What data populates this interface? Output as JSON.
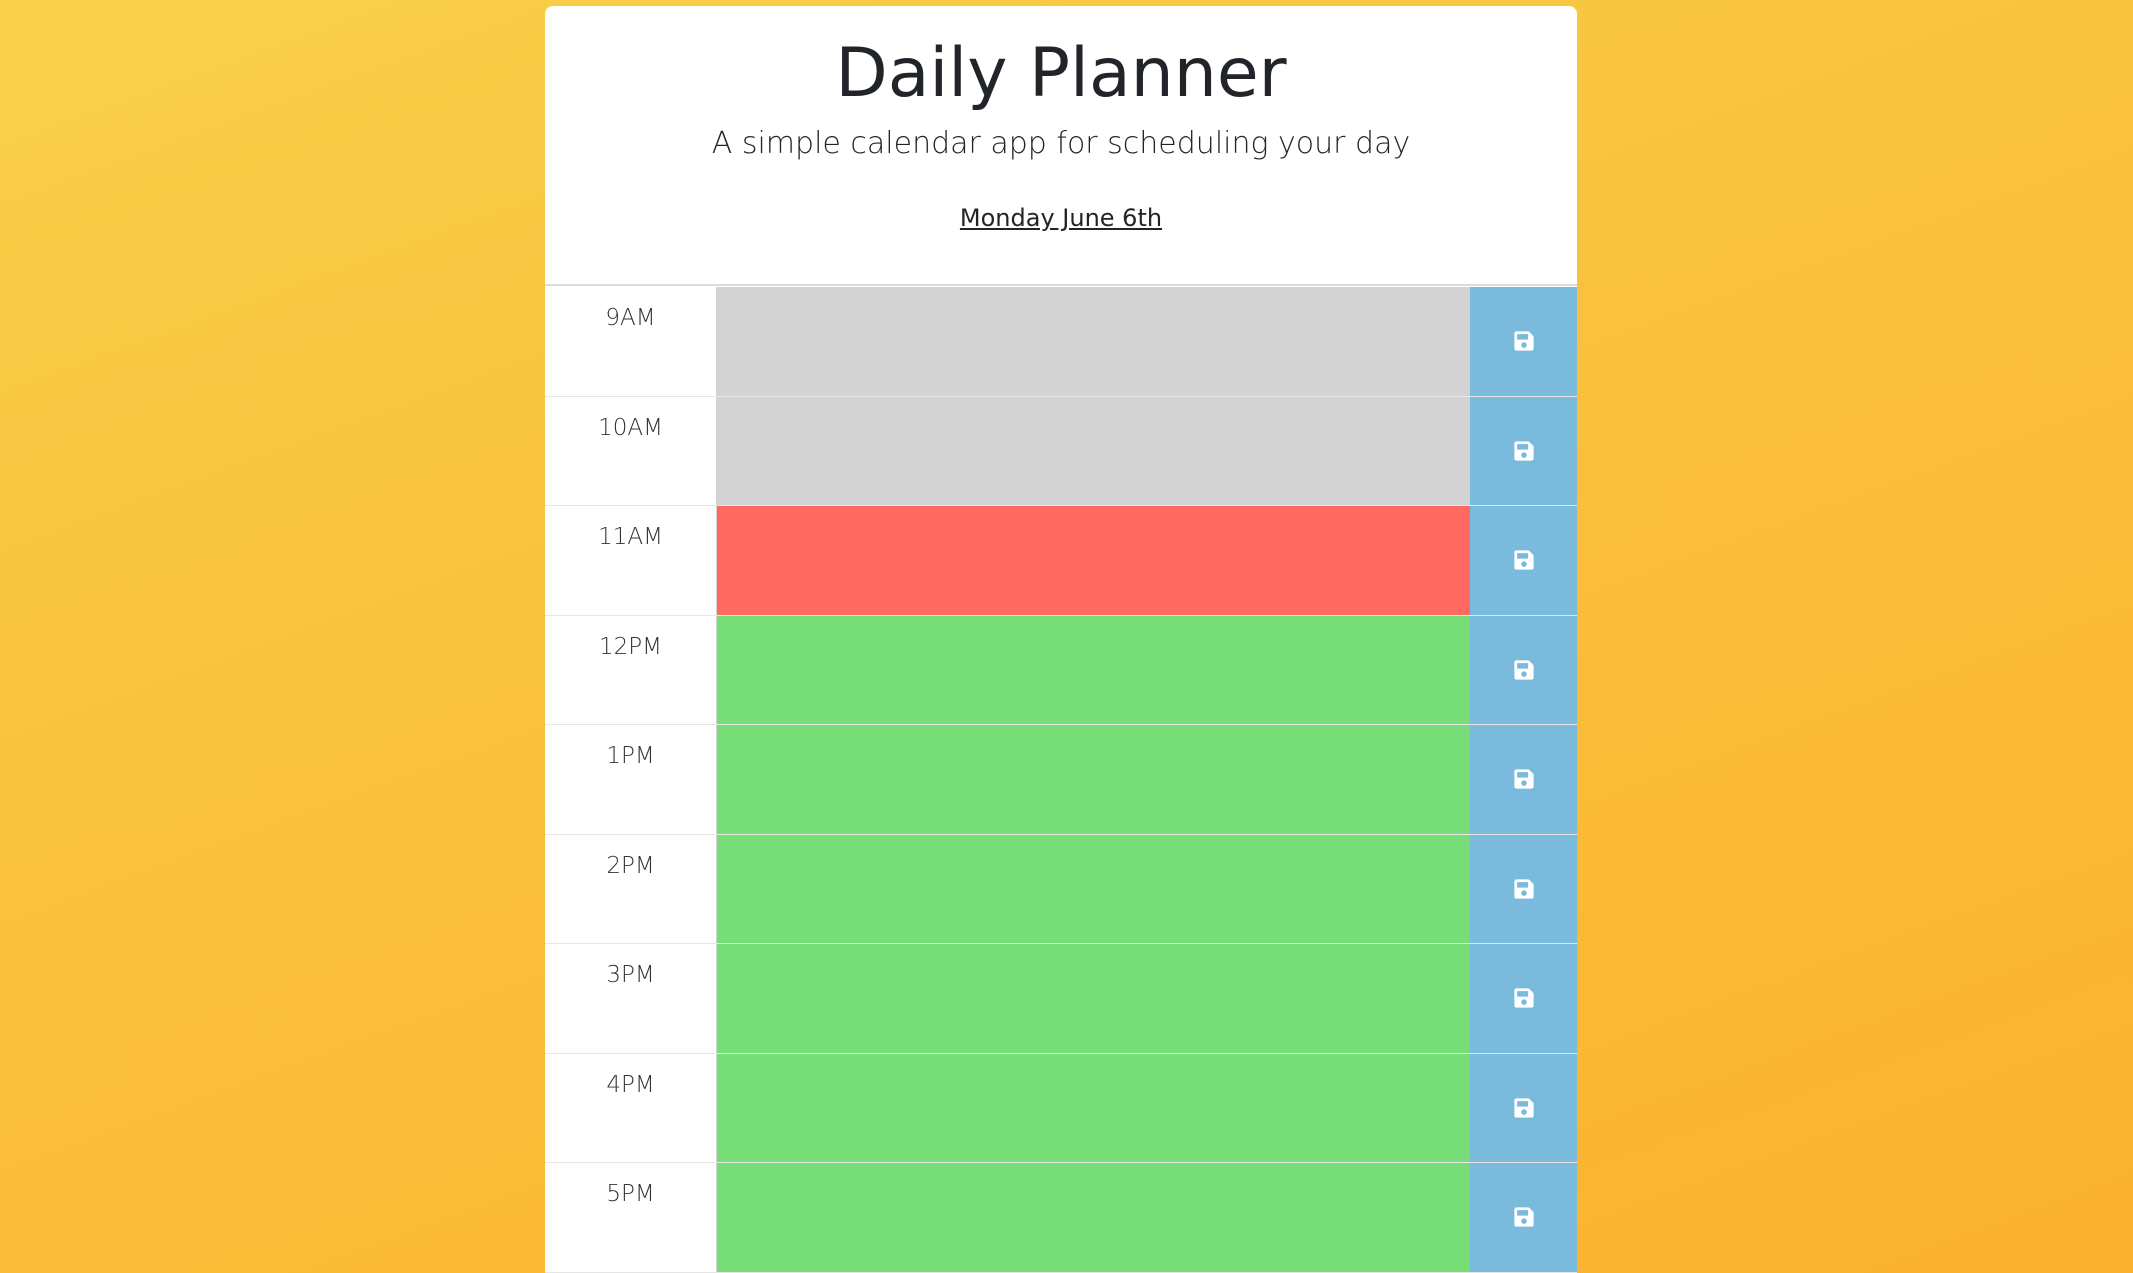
{
  "header": {
    "title": "Daily Planner",
    "subtitle": "A simple calendar app for scheduling your day",
    "current_day": "Monday June 6th"
  },
  "colors": {
    "background_start": "#f9d04a",
    "background_end": "#fbb22e",
    "past": "#d3d3d3",
    "present": "#ff6961",
    "future": "#77dd77",
    "save_button": "#7abadc"
  },
  "rows": [
    {
      "hour": "9AM",
      "state": "past",
      "text": "",
      "icon": "save-icon"
    },
    {
      "hour": "10AM",
      "state": "past",
      "text": "",
      "icon": "save-icon"
    },
    {
      "hour": "11AM",
      "state": "present",
      "text": "",
      "icon": "save-icon"
    },
    {
      "hour": "12PM",
      "state": "future",
      "text": "",
      "icon": "save-icon"
    },
    {
      "hour": "1PM",
      "state": "future",
      "text": "",
      "icon": "save-icon"
    },
    {
      "hour": "2PM",
      "state": "future",
      "text": "",
      "icon": "save-icon"
    },
    {
      "hour": "3PM",
      "state": "future",
      "text": "",
      "icon": "save-icon"
    },
    {
      "hour": "4PM",
      "state": "future",
      "text": "",
      "icon": "save-icon"
    },
    {
      "hour": "5PM",
      "state": "future",
      "text": "",
      "icon": "save-icon"
    }
  ]
}
